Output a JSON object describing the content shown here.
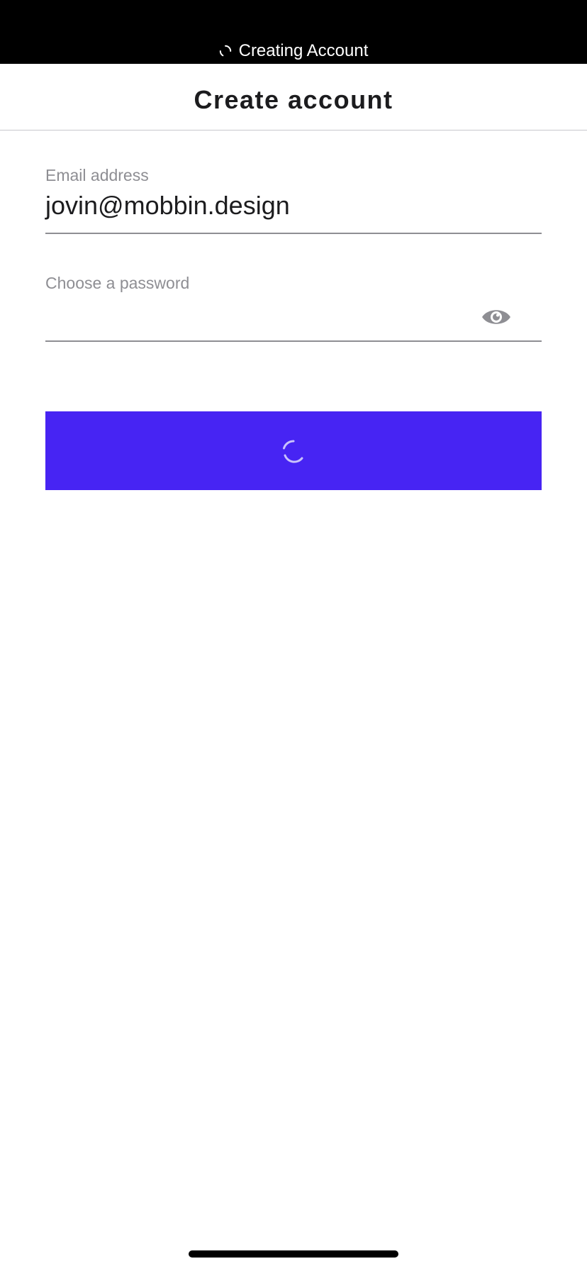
{
  "status_bar": {
    "activity_text": "Creating Account",
    "spinner_icon": "spinner-icon"
  },
  "header": {
    "title": "Create account"
  },
  "form": {
    "email": {
      "label": "Email address",
      "value": "jovin@mobbin.design"
    },
    "password": {
      "label": "Choose a password",
      "value": "",
      "toggle_icon": "eye-icon"
    },
    "submit": {
      "state": "loading",
      "icon": "loading-spinner-icon"
    }
  },
  "colors": {
    "accent": "#4724f3",
    "label": "#8e8e93",
    "text": "#1c1c1e",
    "status_bar": "#000000"
  }
}
